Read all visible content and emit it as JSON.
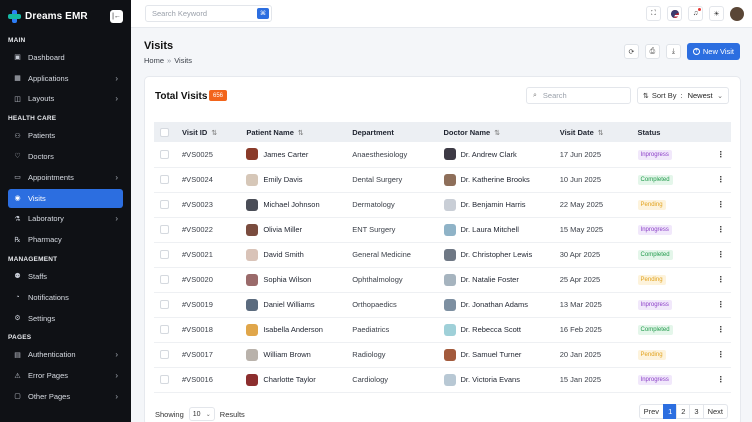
{
  "brand": {
    "name": "Dreams EMR",
    "collapse_icon": "sidebar-toggle-icon"
  },
  "sidebar": {
    "sections": [
      {
        "title": "MAIN",
        "items": [
          {
            "label": "Dashboard",
            "icon": "dashboard-icon",
            "glyph": "▣",
            "chevron": false,
            "active": false
          },
          {
            "label": "Applications",
            "icon": "apps-icon",
            "glyph": "▦",
            "chevron": true,
            "active": false
          },
          {
            "label": "Layouts",
            "icon": "layout-icon",
            "glyph": "◫",
            "chevron": true,
            "active": false
          }
        ]
      },
      {
        "title": "HEALTH CARE",
        "items": [
          {
            "label": "Patients",
            "icon": "patients-icon",
            "glyph": "⚇",
            "chevron": false,
            "active": false
          },
          {
            "label": "Doctors",
            "icon": "stethoscope-icon",
            "glyph": "♡",
            "chevron": false,
            "active": false
          },
          {
            "label": "Appointments",
            "icon": "calendar-icon",
            "glyph": "▭",
            "chevron": true,
            "active": false
          },
          {
            "label": "Visits",
            "icon": "visits-icon",
            "glyph": "◉",
            "chevron": false,
            "active": true
          },
          {
            "label": "Laboratory",
            "icon": "lab-icon",
            "glyph": "⚗",
            "chevron": true,
            "active": false
          },
          {
            "label": "Pharmacy",
            "icon": "pharmacy-icon",
            "glyph": "℞",
            "chevron": false,
            "active": false
          }
        ]
      },
      {
        "title": "MANAGEMENT",
        "items": [
          {
            "label": "Staffs",
            "icon": "staff-icon",
            "glyph": "⚉",
            "chevron": false,
            "active": false
          },
          {
            "label": "Notifications",
            "icon": "bell-icon",
            "glyph": "◔",
            "chevron": false,
            "active": false
          },
          {
            "label": "Settings",
            "icon": "gear-icon",
            "glyph": "⚙",
            "chevron": false,
            "active": false
          }
        ]
      },
      {
        "title": "PAGES",
        "items": [
          {
            "label": "Authentication",
            "icon": "lock-icon",
            "glyph": "▤",
            "chevron": true,
            "active": false
          },
          {
            "label": "Error Pages",
            "icon": "error-icon",
            "glyph": "⚠",
            "chevron": true,
            "active": false
          },
          {
            "label": "Other Pages",
            "icon": "file-icon",
            "glyph": "▢",
            "chevron": true,
            "active": false
          }
        ]
      }
    ]
  },
  "topbar": {
    "search_placeholder": "Search Keyword",
    "search_shortcut_icon": "command-icon",
    "icons": [
      "fullscreen-icon",
      "flag-us-icon",
      "bell-icon",
      "sun-icon"
    ]
  },
  "page": {
    "title": "Visits",
    "breadcrumb": [
      "Home",
      "Visits"
    ],
    "actions": [
      "refresh-icon",
      "print-icon",
      "download-icon"
    ],
    "new_button": "New Visit"
  },
  "card": {
    "title": "Total Visits",
    "count": "656",
    "search_placeholder": "Search",
    "sort_label": "Sort By",
    "sort_value": "Newest"
  },
  "table": {
    "headers": [
      "Visit ID",
      "Patient Name",
      "Department",
      "Doctor Name",
      "Visit Date",
      "Status"
    ],
    "rows": [
      {
        "id": "#VS0025",
        "patient": "James Carter",
        "dept": "Anaesthesiology",
        "doctor": "Dr. Andrew Clark",
        "date": "17 Jun 2025",
        "status": "Inprogress",
        "pc": "#8a3b2a",
        "dc": "#3d3a45"
      },
      {
        "id": "#VS0024",
        "patient": "Emily Davis",
        "dept": "Dental Surgery",
        "doctor": "Dr. Katherine Brooks",
        "date": "10 Jun 2025",
        "status": "Completed",
        "pc": "#d6c7b8",
        "dc": "#8e6f5a"
      },
      {
        "id": "#VS0023",
        "patient": "Michael Johnson",
        "dept": "Dermatology",
        "doctor": "Dr. Benjamin Harris",
        "date": "22 May 2025",
        "status": "Pending",
        "pc": "#4a4d57",
        "dc": "#c9ced6"
      },
      {
        "id": "#VS0022",
        "patient": "Olivia Miller",
        "dept": "ENT Surgery",
        "doctor": "Dr. Laura Mitchell",
        "date": "15 May 2025",
        "status": "Inprogress",
        "pc": "#7a4c3e",
        "dc": "#8fb3c7"
      },
      {
        "id": "#VS0021",
        "patient": "David Smith",
        "dept": "General Medicine",
        "doctor": "Dr. Christopher Lewis",
        "date": "30 Apr 2025",
        "status": "Completed",
        "pc": "#d9c3b8",
        "dc": "#6f7885"
      },
      {
        "id": "#VS0020",
        "patient": "Sophia Wilson",
        "dept": "Ophthalmology",
        "doctor": "Dr. Natalie Foster",
        "date": "25 Apr 2025",
        "status": "Pending",
        "pc": "#9a6a6a",
        "dc": "#a6b4bf"
      },
      {
        "id": "#VS0019",
        "patient": "Daniel Williams",
        "dept": "Orthopaedics",
        "doctor": "Dr. Jonathan Adams",
        "date": "13 Mar 2025",
        "status": "Inprogress",
        "pc": "#5b6b7e",
        "dc": "#7d8fa1"
      },
      {
        "id": "#VS0018",
        "patient": "Isabella Anderson",
        "dept": "Paediatrics",
        "doctor": "Dr. Rebecca Scott",
        "date": "16 Feb 2025",
        "status": "Completed",
        "pc": "#e0a64a",
        "dc": "#9fd0d8"
      },
      {
        "id": "#VS0017",
        "patient": "William Brown",
        "dept": "Radiology",
        "doctor": "Dr. Samuel Turner",
        "date": "20 Jan 2025",
        "status": "Pending",
        "pc": "#b9b2ab",
        "dc": "#a35a3c"
      },
      {
        "id": "#VS0016",
        "patient": "Charlotte Taylor",
        "dept": "Cardiology",
        "doctor": "Dr. Victoria Evans",
        "date": "15 Jan 2025",
        "status": "Inprogress",
        "pc": "#8c2e2e",
        "dc": "#b8c8d4"
      }
    ]
  },
  "footer": {
    "showing": "Showing",
    "per_page": "10",
    "results": "Results",
    "pager": [
      "Prev",
      "1",
      "2",
      "3",
      "Next"
    ],
    "current_page": "1"
  },
  "colors": {
    "accent": "#2c6ee0",
    "sidebar_bg": "#0f1115",
    "badge": "#f2641b"
  }
}
